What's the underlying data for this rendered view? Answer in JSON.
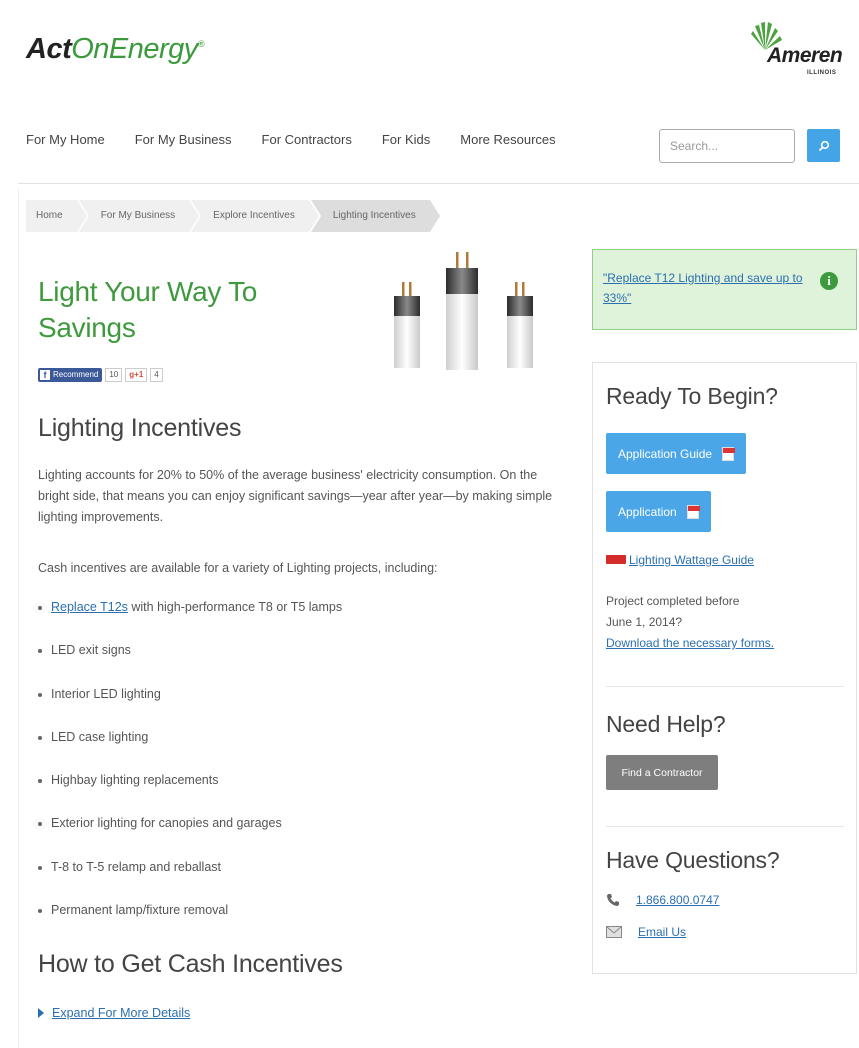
{
  "header": {
    "logo_part1": "Act",
    "logo_part2": "OnEnergy",
    "logo_mark": "®",
    "partner_logo": "Ameren",
    "partner_sub": "ILLINOIS"
  },
  "nav": {
    "items": [
      "For My Home",
      "For My Business",
      "For Contractors",
      "For Kids",
      "More Resources"
    ],
    "search_placeholder": "Search..."
  },
  "breadcrumb": [
    "Home",
    "For My Business",
    "Explore Incentives",
    "Lighting Incentives"
  ],
  "main": {
    "title": "Light Your Way To Savings",
    "social": {
      "recommend": "Recommend",
      "recommend_count": "10",
      "gplus": "g+1",
      "gplus_count": "4"
    },
    "section_title": "Lighting Incentives",
    "intro": "Lighting accounts for 20% to 50% of the average business' electricity consumption. On the bright side, that means you can enjoy significant savings—year after year—by making simple lighting improvements.",
    "cash_intro": "Cash incentives are available for a variety of Lighting projects, including:",
    "bullet_link": "Replace T12s",
    "bullet_link_rest": " with high-performance T8 or T5 lamps",
    "bullets": [
      "LED exit signs",
      "Interior LED lighting",
      "LED case lighting",
      "Highbay lighting replacements",
      "Exterior lighting for canopies and garages",
      "T-8 to T-5 relamp and reballast",
      "Permanent lamp/fixture removal"
    ],
    "how_title": "How to Get Cash Incentives",
    "expand_label": "Expand For More Details"
  },
  "sidebar": {
    "alert_text": "\"Replace T12 Lighting and save up to 33%\"",
    "ready_title": "Ready To Begin?",
    "app_guide": "Application Guide",
    "application": "Application",
    "wattage_guide": "Lighting Wattage Guide",
    "project_text_1": "Project completed before",
    "project_text_2": "June 1, 2014?",
    "download_link": "Download the necessary forms.",
    "help_title": "Need Help?",
    "find_contractor": "Find a Contractor",
    "questions_title": "Have Questions?",
    "phone": "1.866.800.0747",
    "email": "Email Us"
  },
  "colors": {
    "brand_green": "#3f9a3e",
    "link_blue": "#2b6fb0",
    "button_blue": "#4aa6e6",
    "alert_bg": "#dff3da"
  }
}
